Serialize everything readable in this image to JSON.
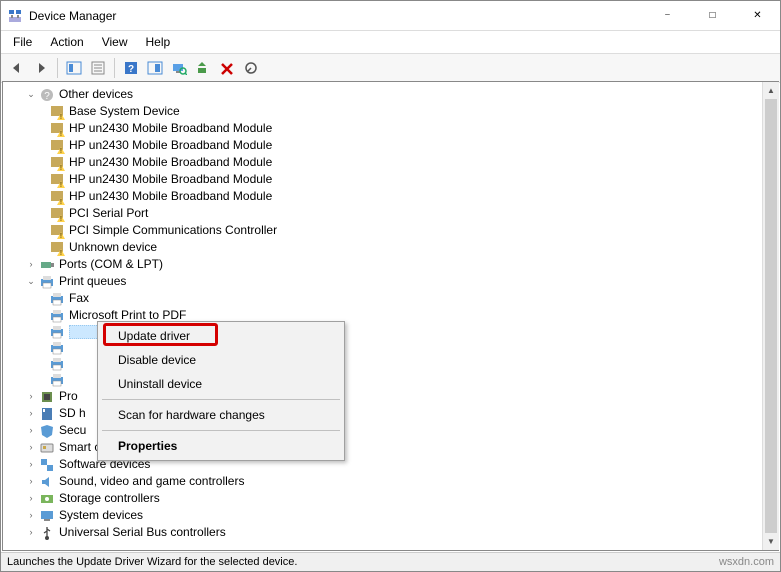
{
  "window": {
    "title": "Device Manager"
  },
  "menubar": [
    "File",
    "Action",
    "View",
    "Help"
  ],
  "tree": {
    "other_devices": {
      "label": "Other devices",
      "children": [
        "Base System Device",
        "HP un2430 Mobile Broadband Module",
        "HP un2430 Mobile Broadband Module",
        "HP un2430 Mobile Broadband Module",
        "HP un2430 Mobile Broadband Module",
        "HP un2430 Mobile Broadband Module",
        "PCI Serial Port",
        "PCI Simple Communications Controller",
        "Unknown device"
      ]
    },
    "ports": {
      "label": "Ports (COM & LPT)"
    },
    "print_queues": {
      "label": "Print queues",
      "children": [
        "Fax",
        "Microsoft Print to PDF",
        "",
        "",
        "",
        ""
      ]
    },
    "processors": {
      "label": "Pro"
    },
    "sd_host": {
      "label": "SD h"
    },
    "security": {
      "label": "Secu"
    },
    "smart_card": {
      "label": "Smart card readers"
    },
    "software": {
      "label": "Software devices"
    },
    "sound": {
      "label": "Sound, video and game controllers"
    },
    "storage": {
      "label": "Storage controllers"
    },
    "system": {
      "label": "System devices"
    },
    "usb": {
      "label": "Universal Serial Bus controllers"
    }
  },
  "context_menu": {
    "update": "Update driver",
    "disable": "Disable device",
    "uninstall": "Uninstall device",
    "scan": "Scan for hardware changes",
    "properties": "Properties"
  },
  "statusbar": {
    "text": "Launches the Update Driver Wizard for the selected device.",
    "watermark": "wsxdn.com"
  }
}
